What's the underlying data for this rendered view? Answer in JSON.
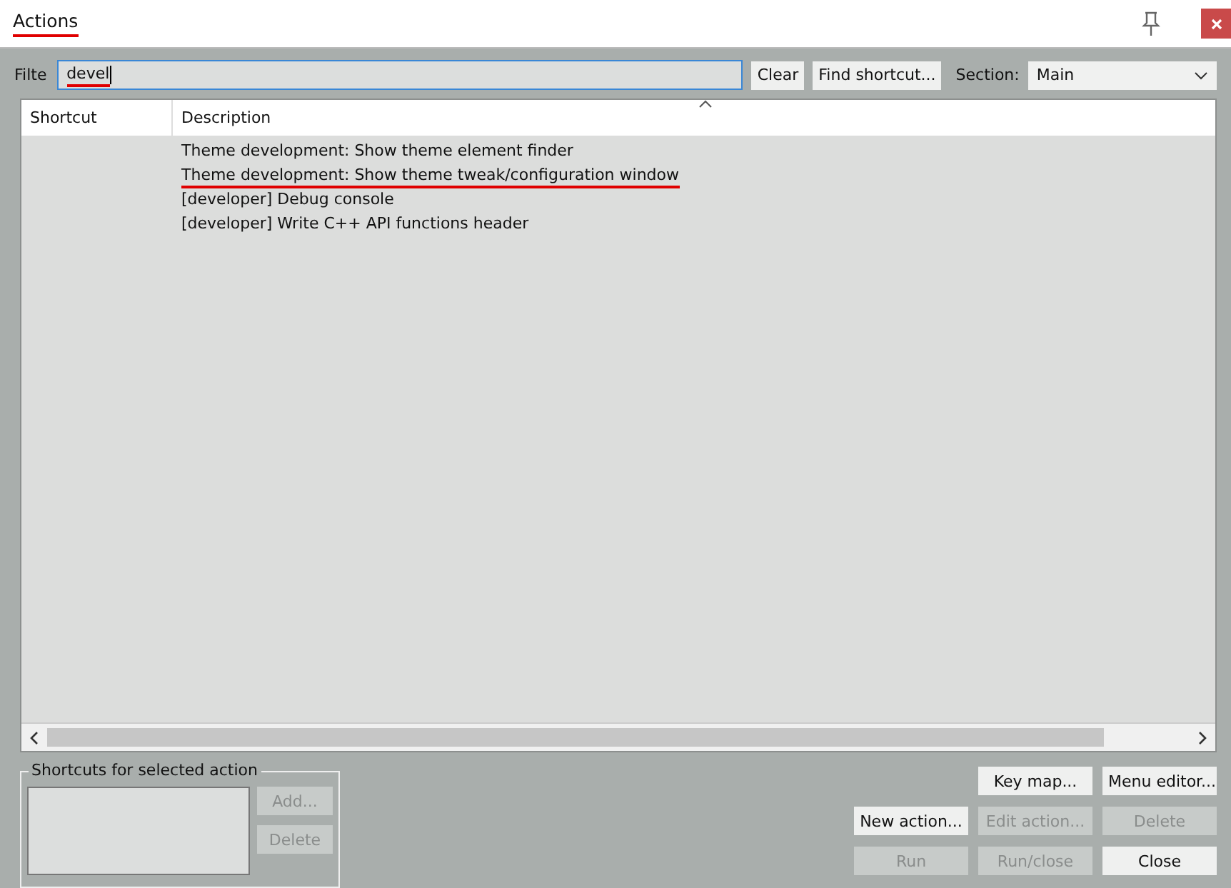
{
  "window": {
    "title": "Actions",
    "title_underlined": true
  },
  "filter": {
    "label": "Filte",
    "value": "devel",
    "underlined": true
  },
  "buttons_top": [
    {
      "label": "Clear"
    },
    {
      "label": "Find shortcut..."
    }
  ],
  "section": {
    "label": "Section:",
    "value": "Main"
  },
  "table": {
    "columns": [
      "Shortcut",
      "Description"
    ],
    "rows": [
      {
        "shortcut": "",
        "description": "Theme development: Show theme element finder",
        "underlined": false
      },
      {
        "shortcut": "",
        "description": "Theme development: Show theme tweak/configuration window",
        "underlined": true
      },
      {
        "shortcut": "",
        "description": "[developer] Debug console",
        "underlined": false
      },
      {
        "shortcut": "",
        "description": "[developer] Write C++ API functions header",
        "underlined": false
      }
    ]
  },
  "shortcuts_group": {
    "title": "Shortcuts for selected action",
    "buttons": [
      {
        "label": "Add...",
        "disabled": true
      },
      {
        "label": "Delete",
        "disabled": true
      }
    ]
  },
  "action_buttons": [
    [
      {
        "label": "Key map...",
        "disabled": false
      },
      {
        "label": "Menu editor...",
        "disabled": false
      }
    ],
    [
      {
        "label": "New action...",
        "disabled": false
      },
      {
        "label": "Edit action...",
        "disabled": true
      },
      {
        "label": "Delete",
        "disabled": true
      }
    ],
    [
      {
        "label": "Run",
        "disabled": true
      },
      {
        "label": "Run/close",
        "disabled": true
      },
      {
        "label": "Close",
        "disabled": false
      }
    ]
  ]
}
